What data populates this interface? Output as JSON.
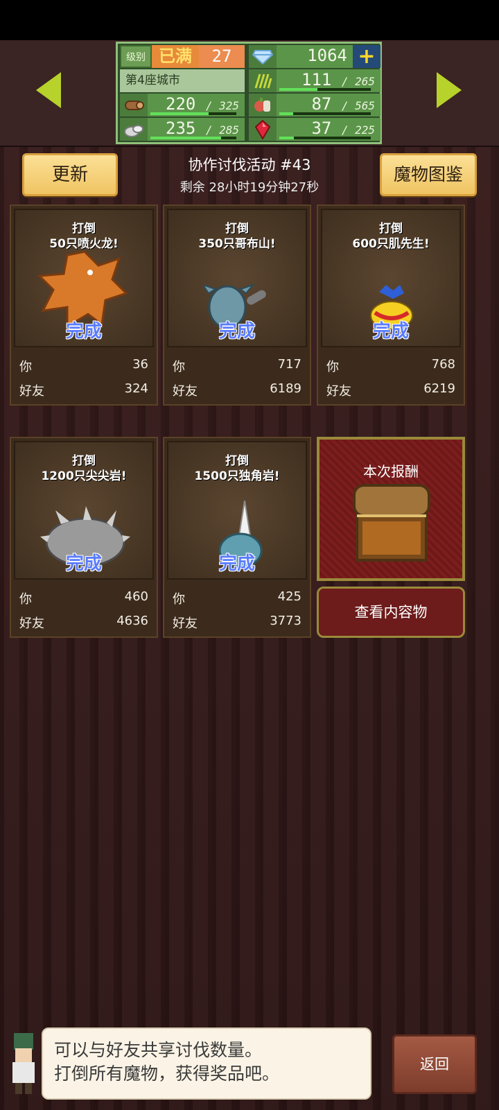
{
  "hud": {
    "level_label": "级别",
    "level_max": "已满",
    "level_value": "27",
    "gems": "1064",
    "city": "第4座城市",
    "resources": [
      {
        "icon": "wood-icon",
        "value": "220",
        "cap": "325",
        "fill": 0.68
      },
      {
        "icon": "stone-icon",
        "value": "235",
        "cap": "285",
        "fill": 0.82
      },
      {
        "icon": "grass-icon",
        "value": "111",
        "cap": "265",
        "fill": 0.42
      },
      {
        "icon": "food-icon",
        "value": "87",
        "cap": "565",
        "fill": 0.15
      },
      {
        "icon": "ruby-icon",
        "value": "37",
        "cap": "225",
        "fill": 0.16
      }
    ]
  },
  "header": {
    "refresh_label": "更新",
    "bestiary_label": "魔物图鉴",
    "event_title": "协作讨伐活动 #43",
    "event_timer": "剩余 28小时19分钟27秒"
  },
  "labels": {
    "you": "你",
    "friends": "好友",
    "complete": "完成"
  },
  "cards": [
    {
      "line1": "打倒",
      "line2": "50只喷火龙!",
      "you": "36",
      "friends": "324"
    },
    {
      "line1": "打倒",
      "line2": "350只哥布山!",
      "you": "717",
      "friends": "6189"
    },
    {
      "line1": "打倒",
      "line2": "600只肌先生!",
      "you": "768",
      "friends": "6219"
    },
    {
      "line1": "打倒",
      "line2": "1200只尖尖岩!",
      "you": "460",
      "friends": "4636"
    },
    {
      "line1": "打倒",
      "line2": "1500只独角岩!",
      "you": "425",
      "friends": "3773"
    }
  ],
  "reward": {
    "title": "本次报酬",
    "button": "查看内容物"
  },
  "footer": {
    "message_line1": "可以与好友共享讨伐数量。",
    "message_line2": "打倒所有魔物，获得奖品吧。",
    "back_label": "返回"
  }
}
